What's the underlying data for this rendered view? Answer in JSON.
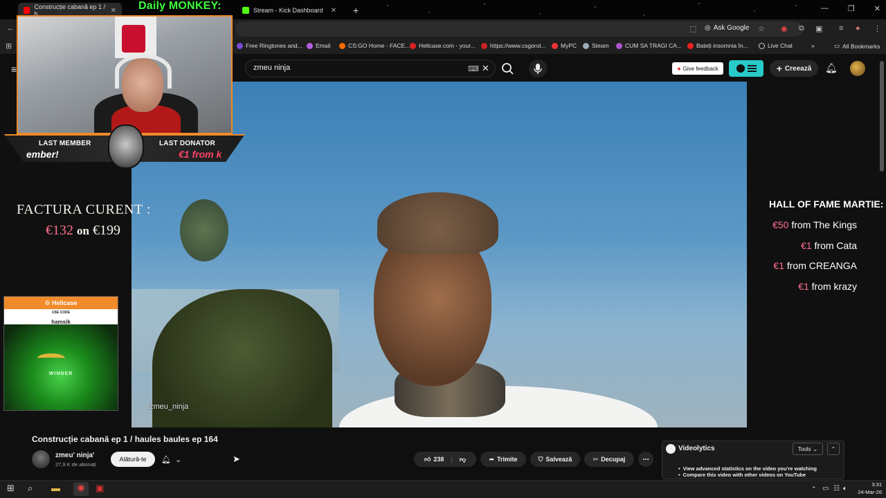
{
  "browser": {
    "tabs": [
      {
        "label": "Construcție cabană ep 1 / h"
      },
      {
        "label": "Stream - Kick Dashboard"
      }
    ],
    "overlay_title": "Daily MONKEY:",
    "ask_google": "Ask Google",
    "bookmarks": [
      {
        "label": "Free Ringtones and..."
      },
      {
        "label": "Email"
      },
      {
        "label": "CS:GO Home - FACE..."
      },
      {
        "label": "Hellcase.com - your..."
      },
      {
        "label": "https://www.csgorol..."
      },
      {
        "label": "MyPC"
      },
      {
        "label": "Steam"
      },
      {
        "label": "CUM SA TRAGI CA..."
      },
      {
        "label": "Bateți insomnia în..."
      },
      {
        "label": "Live Chat"
      }
    ],
    "all_bookmarks": "All Bookmarks"
  },
  "youtube": {
    "search_value": "zmeu ninja",
    "give_feedback": "Give feedback",
    "create_label": "Creează"
  },
  "stream_overlay": {
    "last_member_label": "LAST MEMBER",
    "last_member_value": "ember!",
    "last_donator_label": "LAST DONATOR",
    "last_donator_value": "€1 from k",
    "factura_title": "FACTURA CURENT :",
    "factura_current": "€132",
    "factura_on": "on",
    "factura_goal": "€199",
    "hellcase_brand": "Hellcase",
    "hellcase_use_code": "USE CODE",
    "hellcase_code": "hamsik",
    "hellcase_winner": "WINNER",
    "hof_title": "HALL OF FAME MARTIE:",
    "hof": [
      {
        "amount": "€50",
        "text": "from The Kings"
      },
      {
        "amount": "€1",
        "text": "from Cata"
      },
      {
        "amount": "€1",
        "text": "from CREANGA"
      },
      {
        "amount": "€1",
        "text": "from krazy"
      }
    ]
  },
  "video": {
    "watermark": "zmeu_ninja",
    "title": "Construcție cabană ep 1 / haules baules ep 164",
    "channel_name": "zmeu' ninja'",
    "channel_subs": "27,9 K de abonați",
    "join_label": "Alătură-te",
    "likes": "238",
    "share_label": "Trimite",
    "save_label": "Salvează",
    "clip_label": "Decupaj"
  },
  "videolytics": {
    "title": "Videolytics",
    "tools_label": "Tools",
    "bullets": [
      "View advanced statistics on the video you're watching",
      "Compare this video with other videos on YouTube"
    ]
  },
  "taskbar": {
    "time": "3:31",
    "date": "24-Mar-26"
  }
}
